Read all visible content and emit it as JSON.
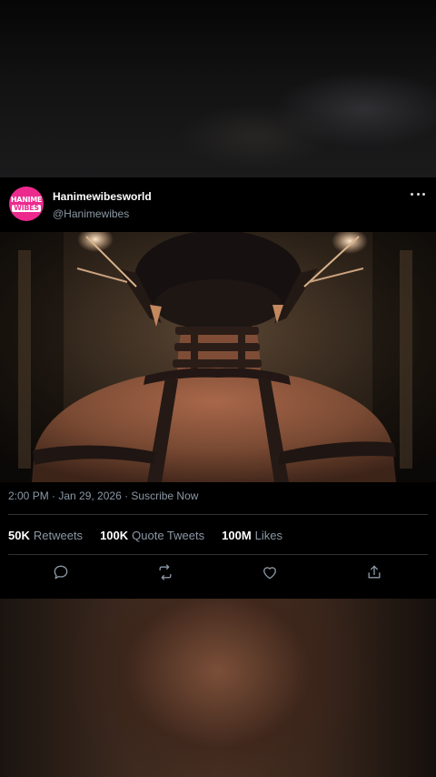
{
  "tweet": {
    "display_name": "Hanimewibesworld",
    "handle": "@Hanimewibes",
    "avatar_logo_line1": "HANIME",
    "avatar_logo_line2": "WIBES",
    "meta": "2:00 PM · Jan 29, 2026 · Suscribe Now",
    "stats": {
      "retweets_count": "50K",
      "retweets_label": "Retweets",
      "quotes_count": "100K",
      "quotes_label": "Quote Tweets",
      "likes_count": "100M",
      "likes_label": "Likes"
    }
  },
  "icons": {
    "more": "more-dots-icon",
    "reply": "reply-bubble-icon",
    "retweet": "retweet-icon",
    "like": "heart-icon",
    "share": "share-icon"
  },
  "colors": {
    "brand_pink": "#ec2a8e",
    "secondary_text": "#8b98a5",
    "divider": "#2f3336"
  }
}
